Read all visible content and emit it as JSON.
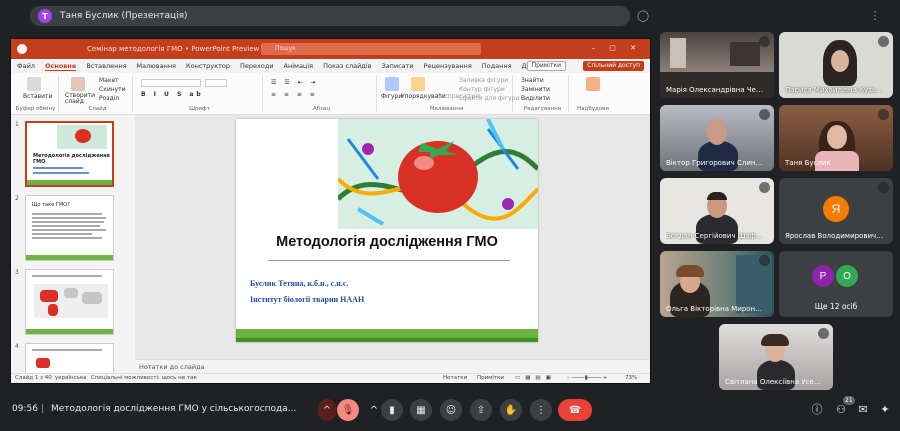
{
  "presenter": {
    "initial": "Т",
    "label": "Таня Буслик (Презентація)"
  },
  "powerpoint": {
    "doc_title": "Семінар методологія ГМО • PowerPoint Preview",
    "search_placeholder": "Пошук",
    "tabs": [
      "Файл",
      "Основне",
      "Вставлення",
      "Малювання",
      "Конструктор",
      "Переходи",
      "Анімація",
      "Показ слайдів",
      "Записати",
      "Рецензування",
      "Подання",
      "Довідка"
    ],
    "active_tab": "Основне",
    "comments_label": "Примітки",
    "share_label": "Спільний доступ",
    "ribbon": {
      "clipboard": "Буфер обміну",
      "paste": "Вставити",
      "slides": "Слайд",
      "new_slide": "Створити слайд",
      "layout": "Макет",
      "reset": "Скинути",
      "sections": "Розділ",
      "font": "Шрифт",
      "paragraph": "Абзац",
      "drawing": "Малювання",
      "shapes": "Фігури",
      "arrange": "Упорядкувати",
      "quick_styles": "Експрес-стилі",
      "shape_fill": "Заливка фігури",
      "shape_outline": "Контур фігури",
      "shape_effects": "Ефекти для фігури",
      "editing": "Редагування",
      "find": "Знайти",
      "replace": "Замінити",
      "select": "Виділити",
      "addins": "Надбудови"
    },
    "thumbnails": [
      {
        "num": "1",
        "title": "Методологія дослідження ГМО"
      },
      {
        "num": "2",
        "title": "Що таке ГМО?"
      },
      {
        "num": "3",
        "title": ""
      },
      {
        "num": "4",
        "title": ""
      }
    ],
    "slide": {
      "title": "Методологія дослідження ГМО",
      "author": "Буслик Тетяна, к.б.н., с.н.с.",
      "institute": "Інститут біології тварин НААН"
    },
    "notes_placeholder": "Нотатки до слайда",
    "status": {
      "slide_count": "Слайд 1 з 40",
      "language": "українська",
      "accessibility": "Спеціальні можливості: щось не так",
      "notes": "Нотатки",
      "comments": "Примітки",
      "zoom": "73%"
    }
  },
  "participants": [
    {
      "name": "Марія Олександрівна Чеченцева"
    },
    {
      "name": "Лариса Михайлівна Кузьменко"
    },
    {
      "name": "Віктор Григорович Слинько"
    },
    {
      "name": "Таня Буслик"
    },
    {
      "name": "Богдан Сергійович Шаферівський"
    },
    {
      "name": "Ярослав Володимирович Глущенко",
      "initial": "Я",
      "color": "#f57c00"
    },
    {
      "name": "Ольга Вікторівна Мироненко"
    },
    {
      "name": "Світлана Олексіївна Усенко"
    }
  ],
  "more": {
    "label": "Ще 12 осіб",
    "avatars": [
      {
        "initial": "Р",
        "color": "#8e24aa"
      },
      {
        "initial": "О",
        "color": "#33a852"
      }
    ]
  },
  "bottom": {
    "time": "09:56",
    "meeting_title": "Методологія дослідження ГМО у сільськогоспода...",
    "participant_count": "21"
  },
  "colors": {
    "accent_red": "#ea4335",
    "pp_orange": "#c43e1c",
    "meet_bg": "#202124"
  }
}
